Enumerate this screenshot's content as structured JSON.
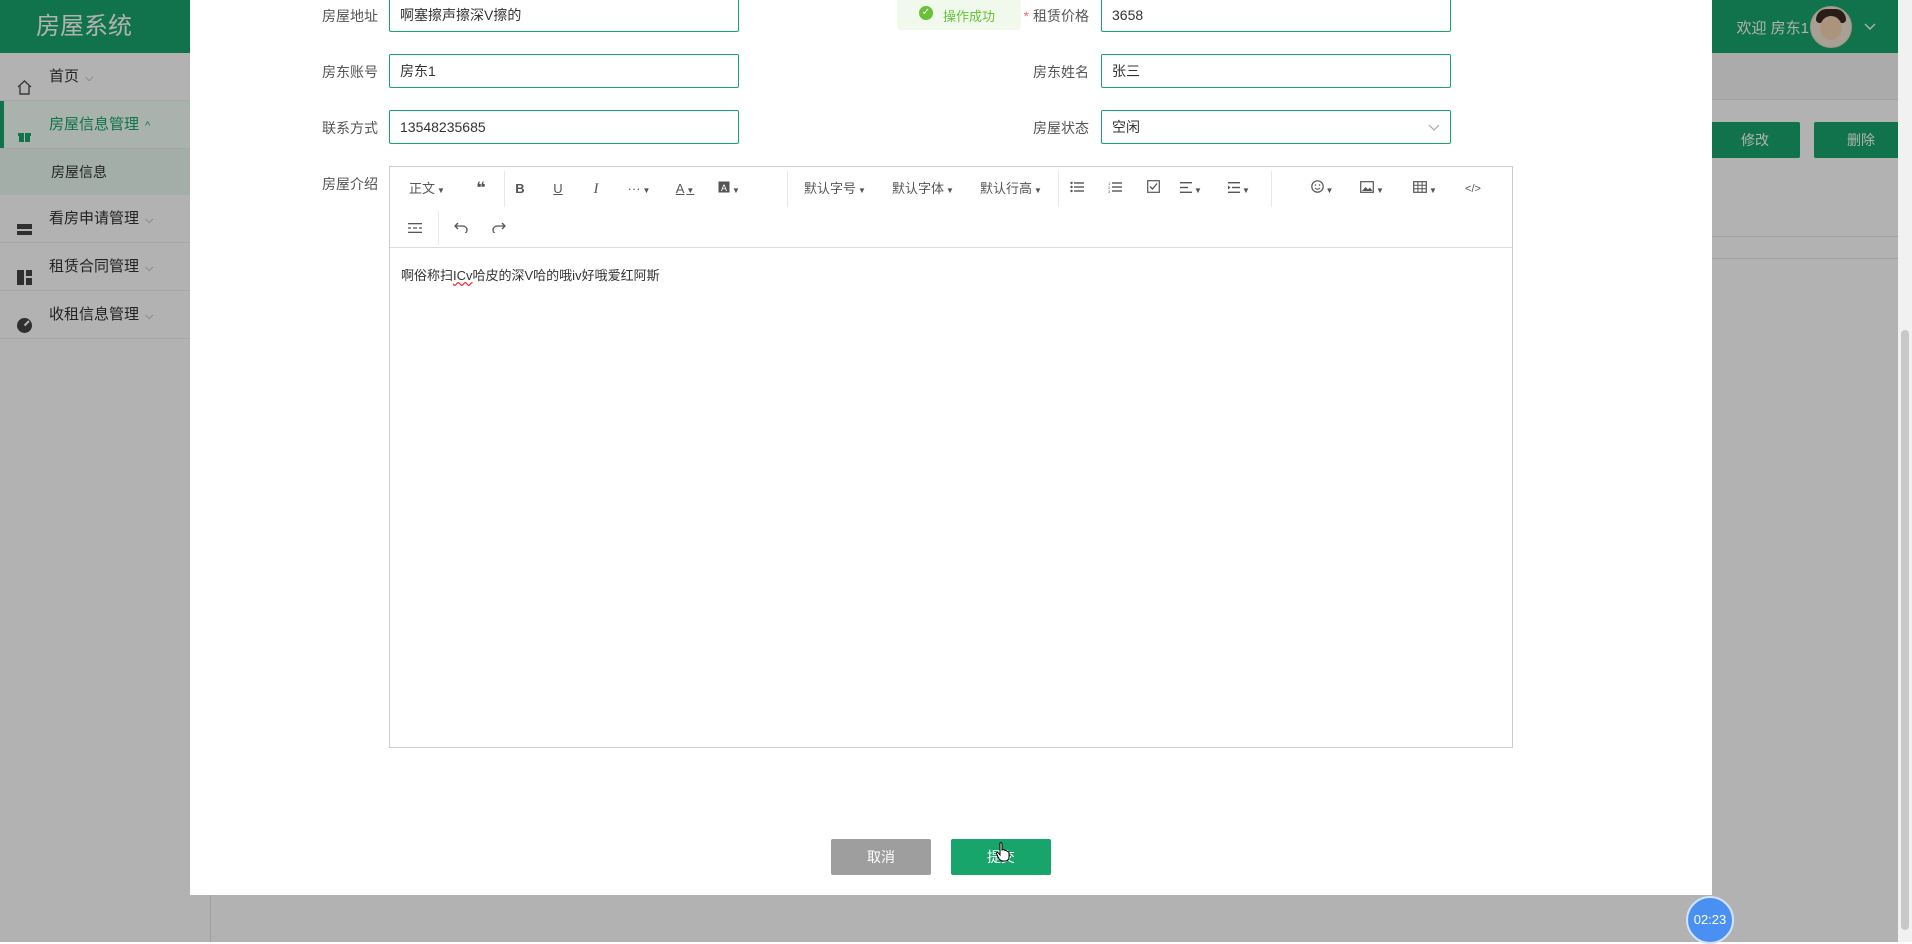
{
  "app": {
    "title": "房屋系统",
    "welcome": "欢迎 房东1"
  },
  "sidebar": {
    "items": [
      {
        "label": "首页",
        "icon": "home-icon"
      },
      {
        "label": "房屋信息管理",
        "icon": "gift-icon",
        "active": true
      },
      {
        "label": "看房申请管理",
        "icon": "layout-icon"
      },
      {
        "label": "租赁合同管理",
        "icon": "grid-icon"
      },
      {
        "label": "收租信息管理",
        "icon": "dashboard-icon"
      }
    ],
    "sub_item": "房屋信息"
  },
  "page_actions": {
    "edit_label": "修改",
    "delete_label": "删除"
  },
  "toast": {
    "text": "操作成功"
  },
  "form": {
    "address_label": "房屋地址",
    "address_value": "啊塞擦声擦深V擦的",
    "price_label": "租赁价格",
    "price_value": "3658",
    "landlord_account_label": "房东账号",
    "landlord_account_value": "房东1",
    "landlord_name_label": "房东姓名",
    "landlord_name_value": "张三",
    "contact_label": "联系方式",
    "contact_value": "13548235685",
    "status_label": "房屋状态",
    "status_value": "空闲",
    "intro_label": "房屋介绍"
  },
  "editor": {
    "paragraph_label": "正文",
    "more_label": "···",
    "font_size_label": "默认字号",
    "font_family_label": "默认字体",
    "line_height_label": "默认行高",
    "content_before": "啊俗称扫",
    "content_err": "ICv",
    "content_after": "哈皮的深V哈的哦iv好哦爱红阿斯"
  },
  "buttons": {
    "cancel_label": "取消",
    "submit_label": "提交"
  },
  "timer": {
    "text": "02:23"
  },
  "colors": {
    "primary": "#17a56c",
    "toast_green": "#67c23a",
    "required": "#f56c6c",
    "timer_blue": "#4a90f2"
  }
}
